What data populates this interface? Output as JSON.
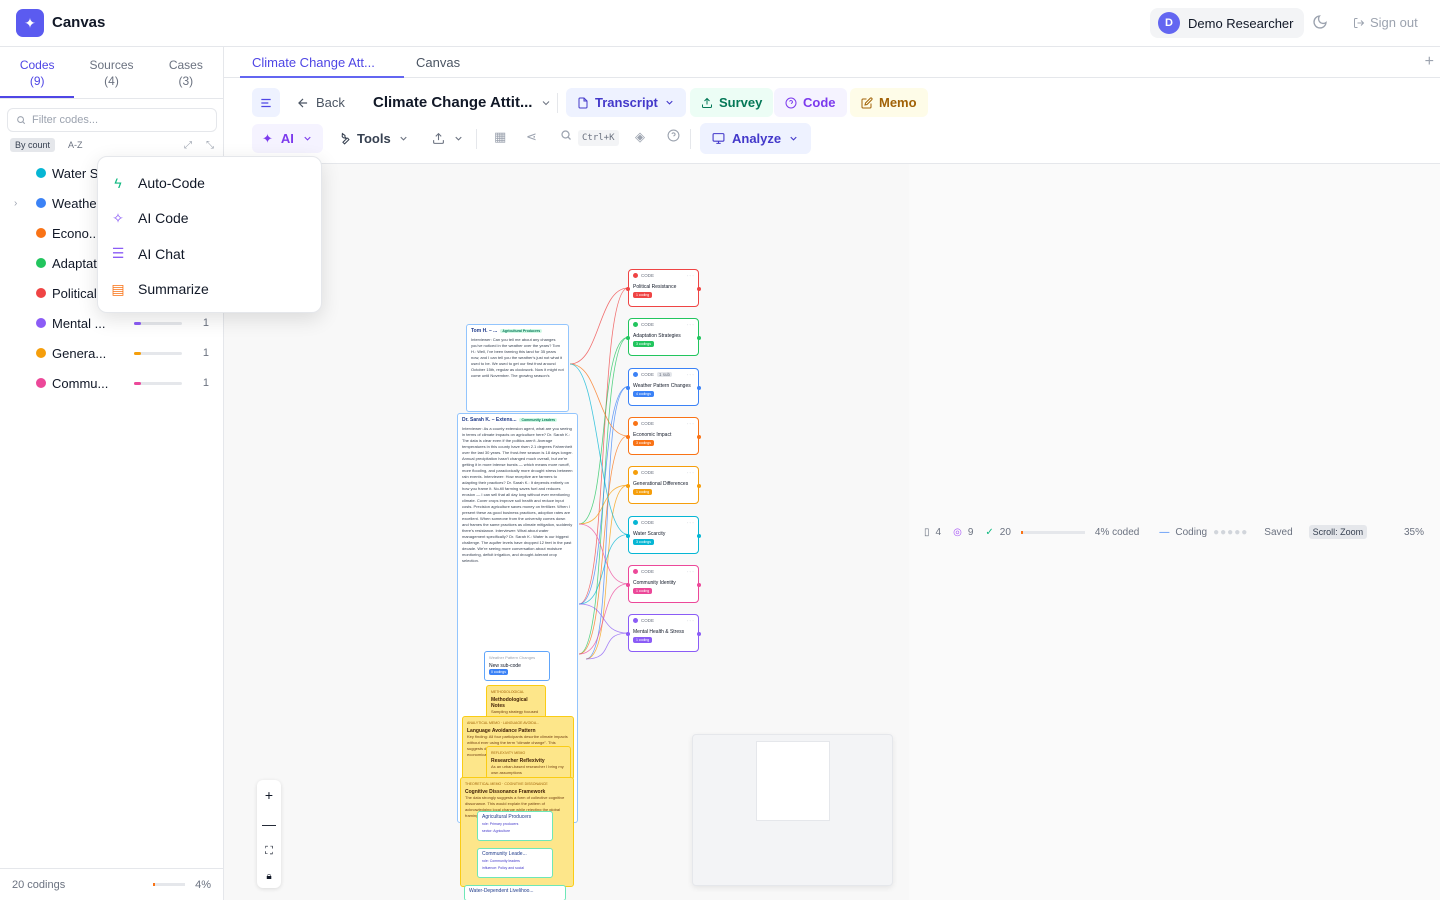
{
  "app": {
    "title": "Canvas",
    "logo_icon": "sparkle-icon"
  },
  "user": {
    "initial": "D",
    "name": "Demo Researcher",
    "signout_label": "Sign out"
  },
  "sidebar": {
    "tabs": [
      {
        "label": "Codes",
        "count": "(9)"
      },
      {
        "label": "Sources",
        "count": "(4)"
      },
      {
        "label": "Cases",
        "count": "(3)"
      }
    ],
    "filter_placeholder": "Filter codes...",
    "sort": {
      "by_count": "By count",
      "az": "A-Z"
    },
    "codes": [
      {
        "name": "Water Scarcity",
        "display": "Water S",
        "color": "#06b6d4",
        "count": "",
        "fill": 0
      },
      {
        "name": "Weather Pattern Changes",
        "display": "Weathe",
        "color": "#3b82f6",
        "count": "",
        "fill": 0,
        "expandable": true
      },
      {
        "name": "Economic Impact",
        "display": "Econo...",
        "color": "#f97316",
        "count": "",
        "fill": 0
      },
      {
        "name": "Adaptation Strategies",
        "display": "Adaptat",
        "color": "#22c55e",
        "count": "",
        "fill": 0
      },
      {
        "name": "Political Resistance",
        "display": "Political",
        "color": "#ef4444",
        "count": "",
        "fill": 0
      },
      {
        "name": "Mental Health & Stress",
        "display": "Mental ...",
        "color": "#8b5cf6",
        "count": "1",
        "fill": 0.15
      },
      {
        "name": "Generational Differences",
        "display": "Genera...",
        "color": "#f59e0b",
        "count": "1",
        "fill": 0.15
      },
      {
        "name": "Community Identity",
        "display": "Commu...",
        "color": "#ec4899",
        "count": "1",
        "fill": 0.15
      }
    ],
    "footer": {
      "codings": "20 codings",
      "percent": "4%"
    }
  },
  "ai_menu": [
    {
      "label": "Auto-Code",
      "icon": "bolt-icon",
      "color": "#10b981"
    },
    {
      "label": "AI Code",
      "icon": "sparkle-icon",
      "color": "#8b5cf6"
    },
    {
      "label": "AI Chat",
      "icon": "chat-icon",
      "color": "#8b5cf6"
    },
    {
      "label": "Summarize",
      "icon": "document-icon",
      "color": "#f97316"
    }
  ],
  "tabs": {
    "active": "Climate Change Att...",
    "second": "Canvas"
  },
  "toolbar": {
    "back": "Back",
    "doc_title": "Climate Change Attit...",
    "transcript": "Transcript",
    "survey": "Survey",
    "code": "Code",
    "memo": "Memo",
    "ai": "AI",
    "tools": "Tools",
    "shortcut": "Ctrl+K",
    "analyze": "Analyze"
  },
  "canvas": {
    "code_nodes": [
      {
        "name": "Political Resistance",
        "color": "#ef4444",
        "badge": "1 coding"
      },
      {
        "name": "Adaptation Strategies",
        "color": "#22c55e",
        "badge": "3 codings"
      },
      {
        "name": "Weather Pattern Changes",
        "color": "#3b82f6",
        "badge": "4 codings",
        "tag": "1 sub"
      },
      {
        "name": "Economic Impact",
        "color": "#f97316",
        "badge": "3 codings"
      },
      {
        "name": "Generational Differences",
        "color": "#f59e0b",
        "badge": "1 coding"
      },
      {
        "name": "Water Scarcity",
        "color": "#06b6d4",
        "badge": "3 codings"
      },
      {
        "name": "Community Identity",
        "color": "#ec4899",
        "badge": "1 coding"
      },
      {
        "name": "Mental Health & Stress",
        "color": "#8b5cf6",
        "badge": "1 coding"
      }
    ],
    "code_label": "CODE",
    "doc1": {
      "title": "Tom H. – ...",
      "badge": "Agricultural Producers",
      "text": "Interviewer: Can you tell me about any changes you've noticed in the weather over the years? Tom H.: Well, I've been farming this land for 35 years now, and I can tell you the weather's just not what it used to be. We used to get our first frost around October 15th, regular as clockwork. Now it might not come until November. The growing season's"
    },
    "doc2": {
      "title": "Dr. Sarah K. – Extens...",
      "badge": "Community Leaders",
      "text": "Interviewer: As a county extension agent, what are you seeing in terms of climate impacts on agriculture here? Dr. Sarah K.: The data is clear even if the politics aren't. Average temperatures in this county have risen 2.1 degrees Fahrenheit over the last 30 years. The frost-free season is 18 days longer. Annual precipitation hasn't changed much overall, but we're getting it in more intense bursts — which means more runoff, more flooding, and paradoxically more drought stress between rain events. Interviewer: How receptive are farmers to adapting their practices? Dr. Sarah K.: It depends entirely on how you frame it. No-till farming saves fuel and reduces erosion — I can sell that all day long without ever mentioning climate. Cover crops improve soil health and reduce input costs. Precision agriculture saves money on fertilizer. When I present these as good business practices, adoption rates are excellent. When someone from the university comes down and frames the same practices as climate mitigation, suddenly there's resistance. Interviewer: What about water management specifically? Dr. Sarah K.: Water is our biggest challenge. The aquifer levels have dropped 12 feet in the past decade. We're seeing more conversation about moisture monitoring, deficit irrigation, and drought-tolerant crop selection."
    },
    "subcode": {
      "parent": "Weather Pattern Changes",
      "name": "New sub-code",
      "badge": "0 codings"
    },
    "memos": [
      {
        "kind": "METHODOLOGICAL",
        "title": "Methodological Notes",
        "body": "Sampling strategy focused on key stakeholders"
      },
      {
        "kind": "ANALYTICAL MEMO · LANGUAGE AVOIDA...",
        "title": "Language Avoidance Pattern",
        "body": "Key finding: All four participants describe climate impacts without ever using the term \"climate change\". This suggests deliberate avoidance. Adaptation is framed economically."
      },
      {
        "kind": "REFLEXIVITY MEMO",
        "title": "Researcher Reflexivity",
        "body": "As an urban-based researcher I bring my own assumptions"
      },
      {
        "kind": "THEORETICAL MEMO · COGNITIVE DISSONANCE",
        "title": "Cognitive Dissonance Framework",
        "body": "The data strongly suggests a form of collective cognitive dissonance. This would explain the pattern of acknowledging local change while rejecting the global framing of it."
      }
    ],
    "cases": [
      {
        "name": "Agricultural Producers",
        "attr1": "role: Primary producers",
        "attr2": "sector: Agriculture"
      },
      {
        "name": "Community Leade...",
        "attr1": "role: Community leaders",
        "attr2": "influence: Policy and social"
      },
      {
        "name": "Water-Dependent Livelihoo...",
        "attr1": "",
        "attr2": ""
      }
    ],
    "status": {
      "sources": "4",
      "codes": "9",
      "codings": "20",
      "coded": "4% coded",
      "coding": "Coding",
      "saved": "Saved",
      "scroll": "Scroll: Zoom",
      "zoom": "35%",
      "coded_fraction": 0.04
    }
  }
}
